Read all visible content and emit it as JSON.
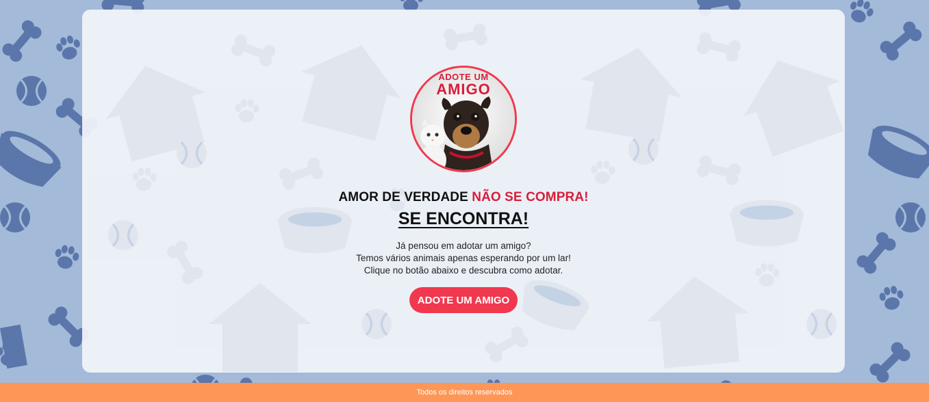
{
  "logo": {
    "line1": "ADOTE UM",
    "line2": "AMIGO",
    "brand_color": "#f0384f"
  },
  "hero": {
    "headline_part1": "AMOR DE VERDADE",
    "headline_part2": "NÃO SE COMPRA!",
    "subheadline": "SE ENCONTRA!",
    "paragraph": [
      "Já pensou em adotar um amigo?",
      "Temos vários animais apenas esperando por um lar!",
      "Clique no botão abaixo e descubra como adotar."
    ],
    "cta_label": "ADOTE UM AMIGO"
  },
  "background": {
    "pattern_icons": [
      "bone-icon",
      "paw-icon",
      "ball-icon",
      "bowl-icon",
      "house-icon"
    ],
    "pattern_color": "#5b76aa",
    "base_color": "#a3bad8"
  },
  "footer": {
    "text": "Todos os direitos reservados",
    "color": "#fe9655"
  }
}
